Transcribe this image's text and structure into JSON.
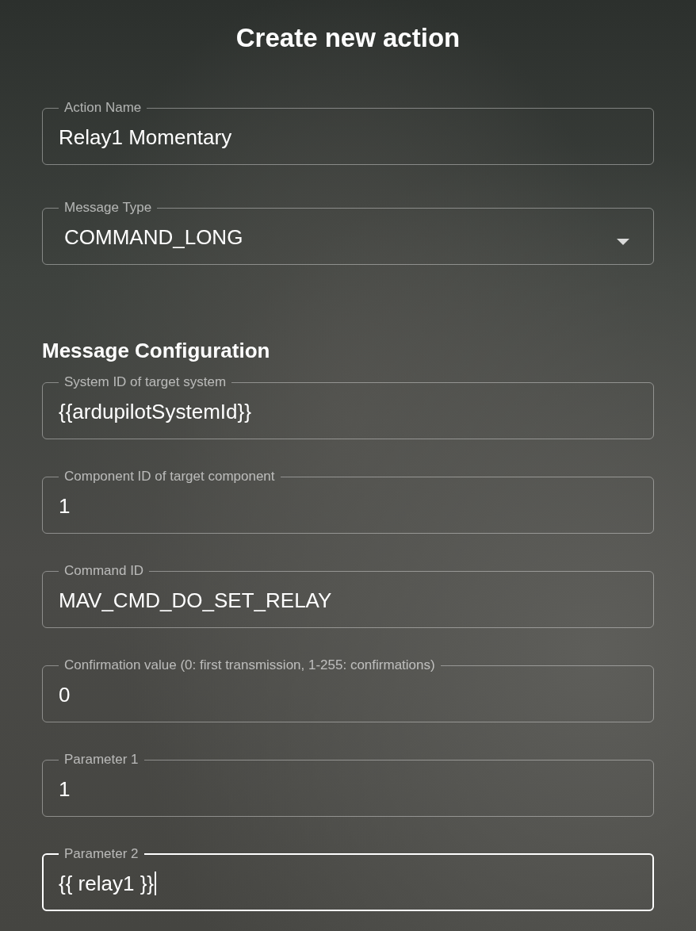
{
  "title": "Create new action",
  "top_fields": [
    {
      "kind": "text",
      "label": "Action Name",
      "value": "Relay1 Momentary",
      "focused": false
    },
    {
      "kind": "select",
      "label": "Message Type",
      "value": "COMMAND_LONG",
      "focused": false
    }
  ],
  "section_heading": "Message Configuration",
  "config_fields": [
    {
      "label": "System ID of target system",
      "value": "{{ardupilotSystemId}}",
      "focused": false
    },
    {
      "label": "Component ID of target component",
      "value": "1",
      "focused": false
    },
    {
      "label": "Command ID",
      "value": "MAV_CMD_DO_SET_RELAY",
      "focused": false
    },
    {
      "label": "Confirmation value (0: first transmission, 1-255: confirmations)",
      "value": "0",
      "focused": false
    },
    {
      "label": "Parameter 1",
      "value": "1",
      "focused": false
    },
    {
      "label": "Parameter 2",
      "value": "{{ relay1 }}",
      "focused": true
    }
  ]
}
